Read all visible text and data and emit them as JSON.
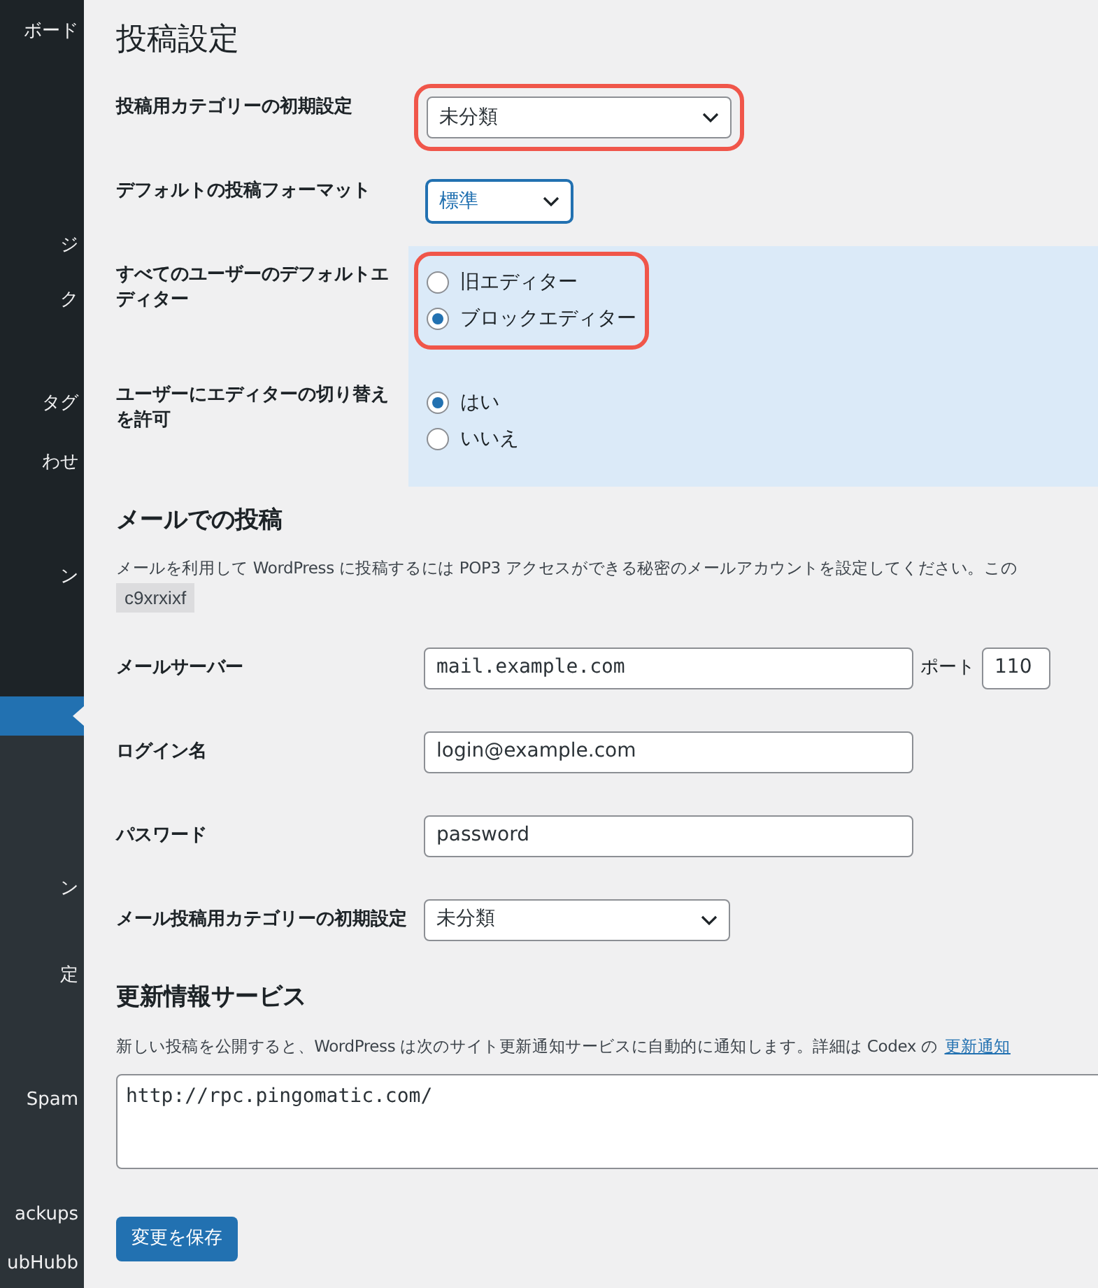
{
  "sidebar": {
    "items": [
      {
        "label": "ボード",
        "selected": false
      },
      {
        "label": "ジ",
        "selected": false
      },
      {
        "label": "ク",
        "selected": false
      },
      {
        "label": "タグ",
        "selected": false
      },
      {
        "label": "わせ",
        "selected": false
      },
      {
        "label": "ン",
        "selected": false
      },
      {
        "selected": true
      },
      {
        "label": "ン",
        "selected": false
      },
      {
        "label": "定",
        "selected": false
      },
      {
        "label": "Spam",
        "selected": false
      },
      {
        "label": "ackups",
        "selected": false
      },
      {
        "label": "ubHubb",
        "selected": false
      }
    ]
  },
  "page_title": "投稿設定",
  "writing_settings": [
    {
      "kind": "select",
      "label": "投稿用カテゴリーの初期設定",
      "value": "未分類",
      "focused": false,
      "highlighted": true,
      "tinted": false
    },
    {
      "kind": "select",
      "label": "デフォルトの投稿フォーマット",
      "value": "標準",
      "focused": true,
      "highlighted": false,
      "tinted": false
    },
    {
      "kind": "radio",
      "label": "すべてのユーザーのデフォルトエディター",
      "highlighted": true,
      "tinted": true,
      "options": [
        {
          "label": "旧エディター",
          "selected": false
        },
        {
          "label": "ブロックエディター",
          "selected": true
        }
      ]
    },
    {
      "kind": "radio",
      "label": "ユーザーにエディターの切り替えを許可",
      "highlighted": false,
      "tinted": true,
      "options": [
        {
          "label": "はい",
          "selected": true
        },
        {
          "label": "いいえ",
          "selected": false
        }
      ]
    }
  ],
  "post_via_email": {
    "heading": "メールでの投稿",
    "description": "メールを利用して WordPress に投稿するには POP3 アクセスができる秘密のメールアカウントを設定してください。この",
    "code": "c9xrxixf",
    "rows": [
      {
        "kind": "server",
        "label": "メールサーバー",
        "value": "mail.example.com",
        "port_label": "ポート",
        "port": "110"
      },
      {
        "kind": "text",
        "label": "ログイン名",
        "value": "login@example.com"
      },
      {
        "kind": "text",
        "label": "パスワード",
        "value": "password"
      },
      {
        "kind": "select",
        "label": "メール投稿用カテゴリーの初期設定",
        "value": "未分類"
      }
    ]
  },
  "update_services": {
    "heading": "更新情報サービス",
    "description": "新しい投稿を公開すると、WordPress は次のサイト更新通知サービスに自動的に通知します。詳細は Codex の",
    "link": "更新通知",
    "urls": "http://rpc.pingomatic.com/"
  },
  "save_button": "変更を保存"
}
